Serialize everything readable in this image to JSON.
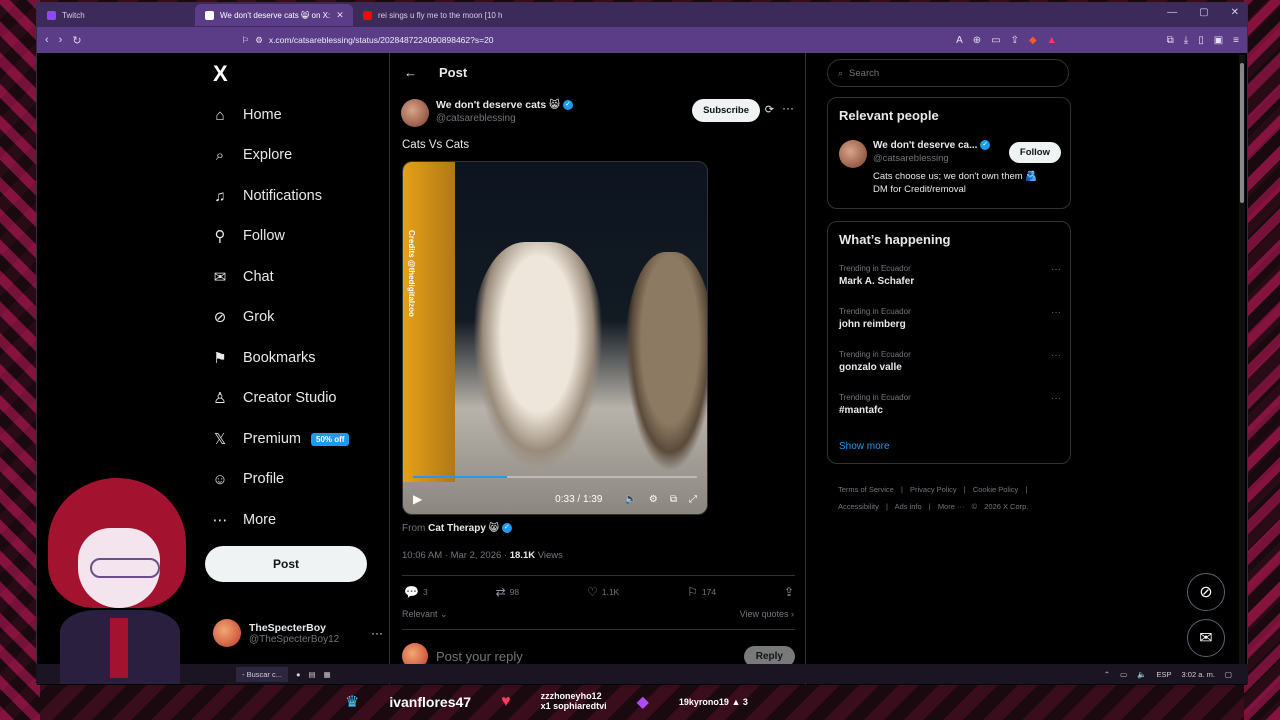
{
  "browser": {
    "tabs": [
      {
        "label": "Twitch",
        "color": "#9146ff",
        "active": false
      },
      {
        "label": "We don't deserve cats 😸 on X:",
        "color": "#ffffff",
        "active": true
      },
      {
        "label": "rei sings u fly me to the moon [10 h",
        "color": "#ff0000",
        "active": false
      }
    ],
    "url": "x.com/catsareblessing/status/2028487224090898462?s=20"
  },
  "nav": {
    "logo": "X",
    "items": [
      {
        "label": "Home",
        "icon": "home-icon",
        "glyph": "⌂"
      },
      {
        "label": "Explore",
        "icon": "search-icon",
        "glyph": "⌕"
      },
      {
        "label": "Notifications",
        "icon": "bell-icon",
        "glyph": "♫"
      },
      {
        "label": "Follow",
        "icon": "person-plus-icon",
        "glyph": "⚲"
      },
      {
        "label": "Chat",
        "icon": "mail-icon",
        "glyph": "✉"
      },
      {
        "label": "Grok",
        "icon": "grok-icon",
        "glyph": "⊘"
      },
      {
        "label": "Bookmarks",
        "icon": "bookmark-icon",
        "glyph": "⚑"
      },
      {
        "label": "Creator Studio",
        "icon": "creator-icon",
        "glyph": "♙"
      },
      {
        "label": "Premium",
        "icon": "x-icon",
        "glyph": "𝕏"
      },
      {
        "label": "Profile",
        "icon": "profile-icon",
        "glyph": "☺"
      },
      {
        "label": "More",
        "icon": "more-circle-icon",
        "glyph": "⋯"
      }
    ],
    "premium_badge": "50% off",
    "post_label": "Post"
  },
  "account": {
    "name": "TheSpecterBoy",
    "handle": "@TheSpecterBoy12",
    "more": "···"
  },
  "post": {
    "header_title": "Post",
    "author_name": "We don't deserve cats 😸",
    "author_handle": "@catsareblessing",
    "subscribe_label": "Subscribe",
    "text": "Cats Vs Cats",
    "video": {
      "credits": "Credits @thedigitalzoo",
      "time": "0:33 / 1:39",
      "progress": 0.33
    },
    "from_prefix": "From",
    "from_name": "Cat Therapy 😸",
    "timestamp": "10:06 AM · Mar 2, 2026 ·",
    "views_count": "18.1K",
    "views_label": "Views",
    "actions": {
      "replies": "3",
      "reposts": "98",
      "likes": "1.1K",
      "bookmarks": "174"
    },
    "relevant_label": "Relevant",
    "view_quotes_label": "View quotes",
    "reply_placeholder": "Post your reply",
    "reply_button": "Reply"
  },
  "sidebar": {
    "search_placeholder": "Search",
    "relevant_people_title": "Relevant people",
    "person": {
      "name": "We don't deserve ca...",
      "handle": "@catsareblessing",
      "bio": "Cats choose us; we don't own them 🫂 DM for Credit/removal",
      "follow_label": "Follow"
    },
    "happening_title": "What’s happening",
    "trends": [
      {
        "context": "Trending in Ecuador",
        "name": "Mark A. Schafer"
      },
      {
        "context": "Trending in Ecuador",
        "name": "john reimberg"
      },
      {
        "context": "Trending in Ecuador",
        "name": "gonzalo valle"
      },
      {
        "context": "Trending in Ecuador",
        "name": "#mantafc"
      }
    ],
    "show_more": "Show more",
    "footer": [
      "Terms of Service",
      "|",
      "Privacy Policy",
      "|",
      "Cookie Policy",
      "|",
      "Accessibility",
      "|",
      "Ads info",
      "|",
      "More ···",
      "©",
      "2026 X Corp."
    ]
  },
  "taskbar": {
    "task": "- Buscar c...",
    "lang": "ESP",
    "time": "3:02 a. m."
  },
  "stream": {
    "name1": "ivanflores47",
    "sub_line1": "zzzhoneyho12",
    "sub_line2": "x1 sophiaredtvi",
    "name3": "19kyrono19",
    "count3": "3"
  },
  "colors": {
    "accent": "#1d9bf0",
    "browser_chrome": "#5a3d86",
    "background": "#000000"
  }
}
